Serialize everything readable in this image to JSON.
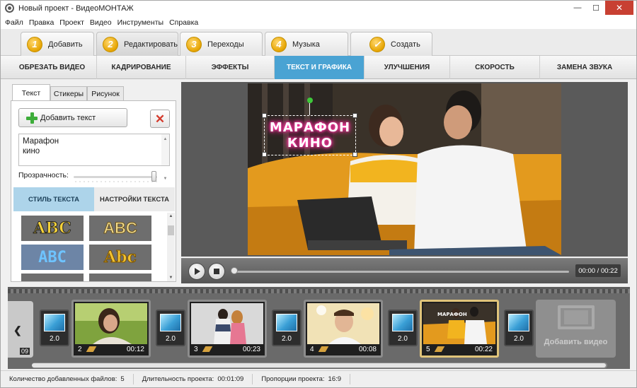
{
  "window": {
    "title": "Новый проект - ВидеоМОНТАЖ"
  },
  "menu": [
    "Файл",
    "Правка",
    "Проект",
    "Видео",
    "Инструменты",
    "Справка"
  ],
  "steps": [
    {
      "num": "1",
      "label": "Добавить"
    },
    {
      "num": "2",
      "label": "Редактировать",
      "active": true
    },
    {
      "num": "3",
      "label": "Переходы"
    },
    {
      "num": "4",
      "label": "Музыка"
    },
    {
      "num": "✓",
      "label": "Создать"
    }
  ],
  "sections": [
    "ОБРЕЗАТЬ ВИДЕО",
    "КАДРИРОВАНИЕ",
    "ЭФФЕКТЫ",
    "ТЕКСТ И ГРАФИКА",
    "УЛУЧШЕНИЯ",
    "СКОРОСТЬ",
    "ЗАМЕНА ЗВУКА"
  ],
  "active_section": "ТЕКСТ И ГРАФИКА",
  "sub_tabs": [
    "Текст",
    "Стикеры",
    "Рисунок"
  ],
  "left_panel": {
    "add_text_label": "Добавить текст",
    "text_lines": [
      "Марафон",
      "кино"
    ],
    "opacity_label": "Прозрачность:",
    "opacity_value": 1.0,
    "style_tabs": [
      "СТИЛЬ ТЕКСТА",
      "НАСТРОЙКИ ТЕКСТА"
    ],
    "style_samples": [
      {
        "text": "ABC",
        "color": "#f5d23a"
      },
      {
        "text": "ABC",
        "color": "#f4dd8c"
      },
      {
        "text": "ABC",
        "color": "#6ec3ff"
      },
      {
        "text": "Abc",
        "color": "#f2c230"
      }
    ]
  },
  "preview": {
    "overlay_text": "МАРАФОН\nКИНО",
    "time": "00:00 / 00:22",
    "progress": 0
  },
  "timeline": {
    "prev_clip_duration": "09",
    "clips": [
      {
        "num": "2",
        "duration": "00:12"
      },
      {
        "num": "3",
        "duration": "00:23"
      },
      {
        "num": "4",
        "duration": "00:08"
      },
      {
        "num": "5",
        "duration": "00:22",
        "selected": true
      }
    ],
    "transitions": [
      "2.0",
      "2.0",
      "2.0",
      "2.0",
      "2.0"
    ],
    "add_video_label": "Добавить видео"
  },
  "status": {
    "files_label": "Количество добавленных файлов:",
    "files_value": "5",
    "duration_label": "Длительность проекта:",
    "duration_value": "00:01:09",
    "ratio_label": "Пропорции проекта:",
    "ratio_value": "16:9"
  },
  "colors": {
    "accent": "#4aa3d3",
    "step_badge": "#e6a400"
  }
}
